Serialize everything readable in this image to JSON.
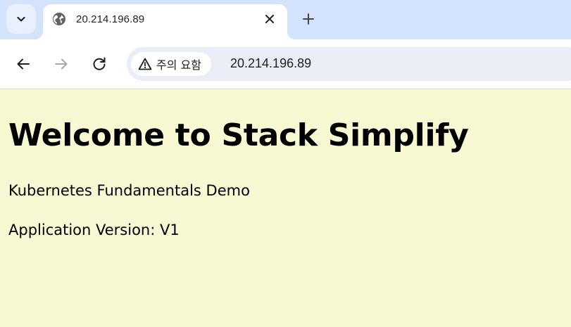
{
  "browser": {
    "tab": {
      "title": "20.214.196.89"
    },
    "icons": {
      "tab_search": "chevron-down-icon",
      "favicon": "globe-icon",
      "close": "close-icon",
      "new_tab": "plus-icon",
      "back": "arrow-left-icon",
      "forward": "arrow-right-icon",
      "reload": "reload-icon",
      "security": "warning-triangle-icon"
    },
    "omnibox": {
      "security_label": "주의 요함",
      "url": "20.214.196.89"
    },
    "colors": {
      "tabstrip": "#d3e3fd",
      "omnibox": "#e9eef6",
      "page_background": "#f8f8d2"
    }
  },
  "page": {
    "heading": "Welcome to Stack Simplify",
    "paragraphs": [
      "Kubernetes Fundamentals Demo",
      "Application Version: V1"
    ]
  }
}
